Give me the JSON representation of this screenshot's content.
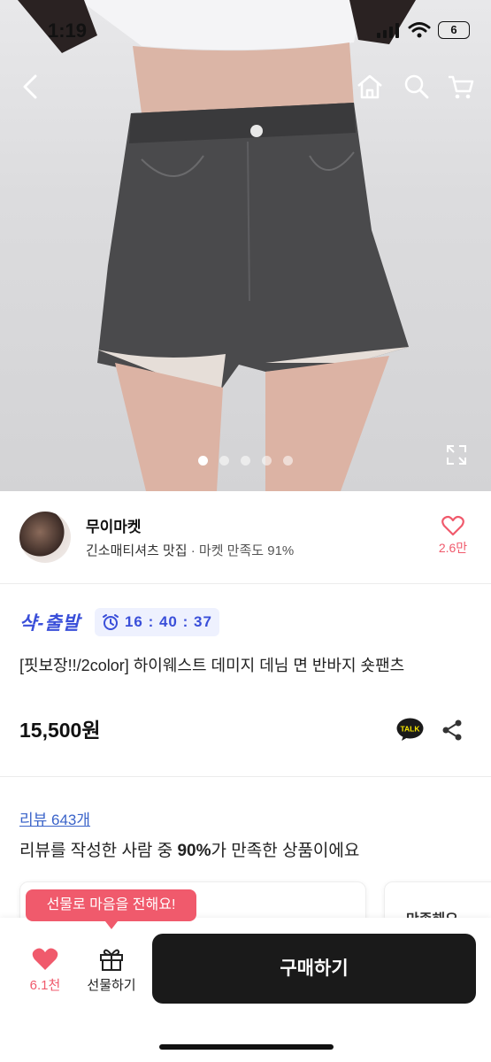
{
  "status_bar": {
    "time": "1:19",
    "battery": "6"
  },
  "seller": {
    "name": "무이마켓",
    "tagline": "긴소매티셔츠 맛집",
    "satisfaction": "· 마켓 만족도 91%",
    "likes": "2.6만"
  },
  "promo": {
    "logo": "샥-출발",
    "timer": "16 : 40 : 37"
  },
  "product": {
    "title": "[핏보장!!/2color] 하이웨스트 데미지 데님 면 반바지 숏팬츠",
    "price": "15,500원",
    "talk_label": "TALK"
  },
  "review": {
    "link": "리뷰 643개",
    "summary_pre": "리뷰를 작성한 사람 중 ",
    "summary_pct": "90%",
    "summary_post": "가 만족한 상품이에요"
  },
  "cards": {
    "second_label": "만족해요"
  },
  "bottom_bar": {
    "tooltip": "선물로 마음을 전해요!",
    "like_count": "6.1천",
    "gift_label": "선물하기",
    "buy_label": "구매하기"
  },
  "carousel": {
    "total": 5,
    "active": 1
  },
  "colors": {
    "accent": "#f05a6c",
    "brand_blue": "#3a4fd9",
    "buy_bg": "#1a1a1a"
  }
}
